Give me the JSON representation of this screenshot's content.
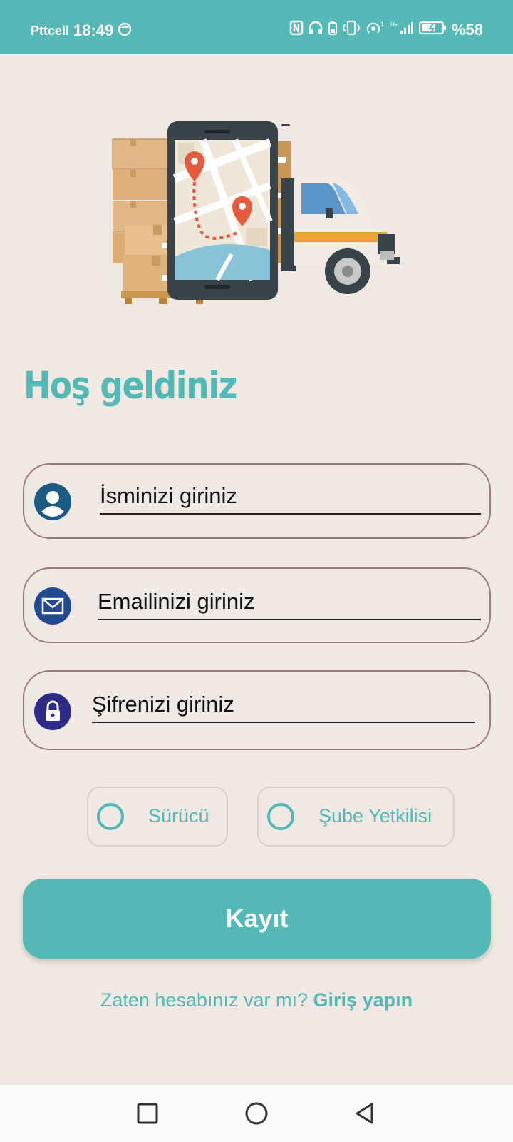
{
  "status_bar": {
    "carrier": "Pttcell",
    "time": "18:49",
    "battery": "%58",
    "icons": [
      "face-icon",
      "nfc-icon",
      "headphones-icon",
      "battery-saver-icon",
      "vibrate-icon",
      "hotspot-icon",
      "signal-icon",
      "battery-icon"
    ]
  },
  "hero": {
    "illustration": "delivery-truck-phone-map-illustration"
  },
  "welcome": {
    "title": "Hoş geldiniz"
  },
  "form": {
    "name": {
      "placeholder": "İsminizi giriniz",
      "icon": "user-icon",
      "icon_color": "#1e5b84"
    },
    "email": {
      "placeholder": "Emailinizi giriniz",
      "icon": "envelope-icon",
      "icon_color": "#234a8e"
    },
    "password": {
      "placeholder": "Şifrenizi giriniz",
      "icon": "lock-icon",
      "icon_color": "#2e2a87"
    }
  },
  "roles": {
    "driver": "Sürücü",
    "branch_manager": "Şube Yetkilisi"
  },
  "register_button": "Kayıt",
  "footer": {
    "question": "Zaten hesabınız var mı?",
    "login_link": "Giriş yapın"
  },
  "colors": {
    "accent": "#54b8b7",
    "background": "#efe8e3",
    "field_border": "#9a7b79"
  },
  "nav": {
    "icons": [
      "recents-icon",
      "home-icon",
      "back-icon"
    ]
  }
}
